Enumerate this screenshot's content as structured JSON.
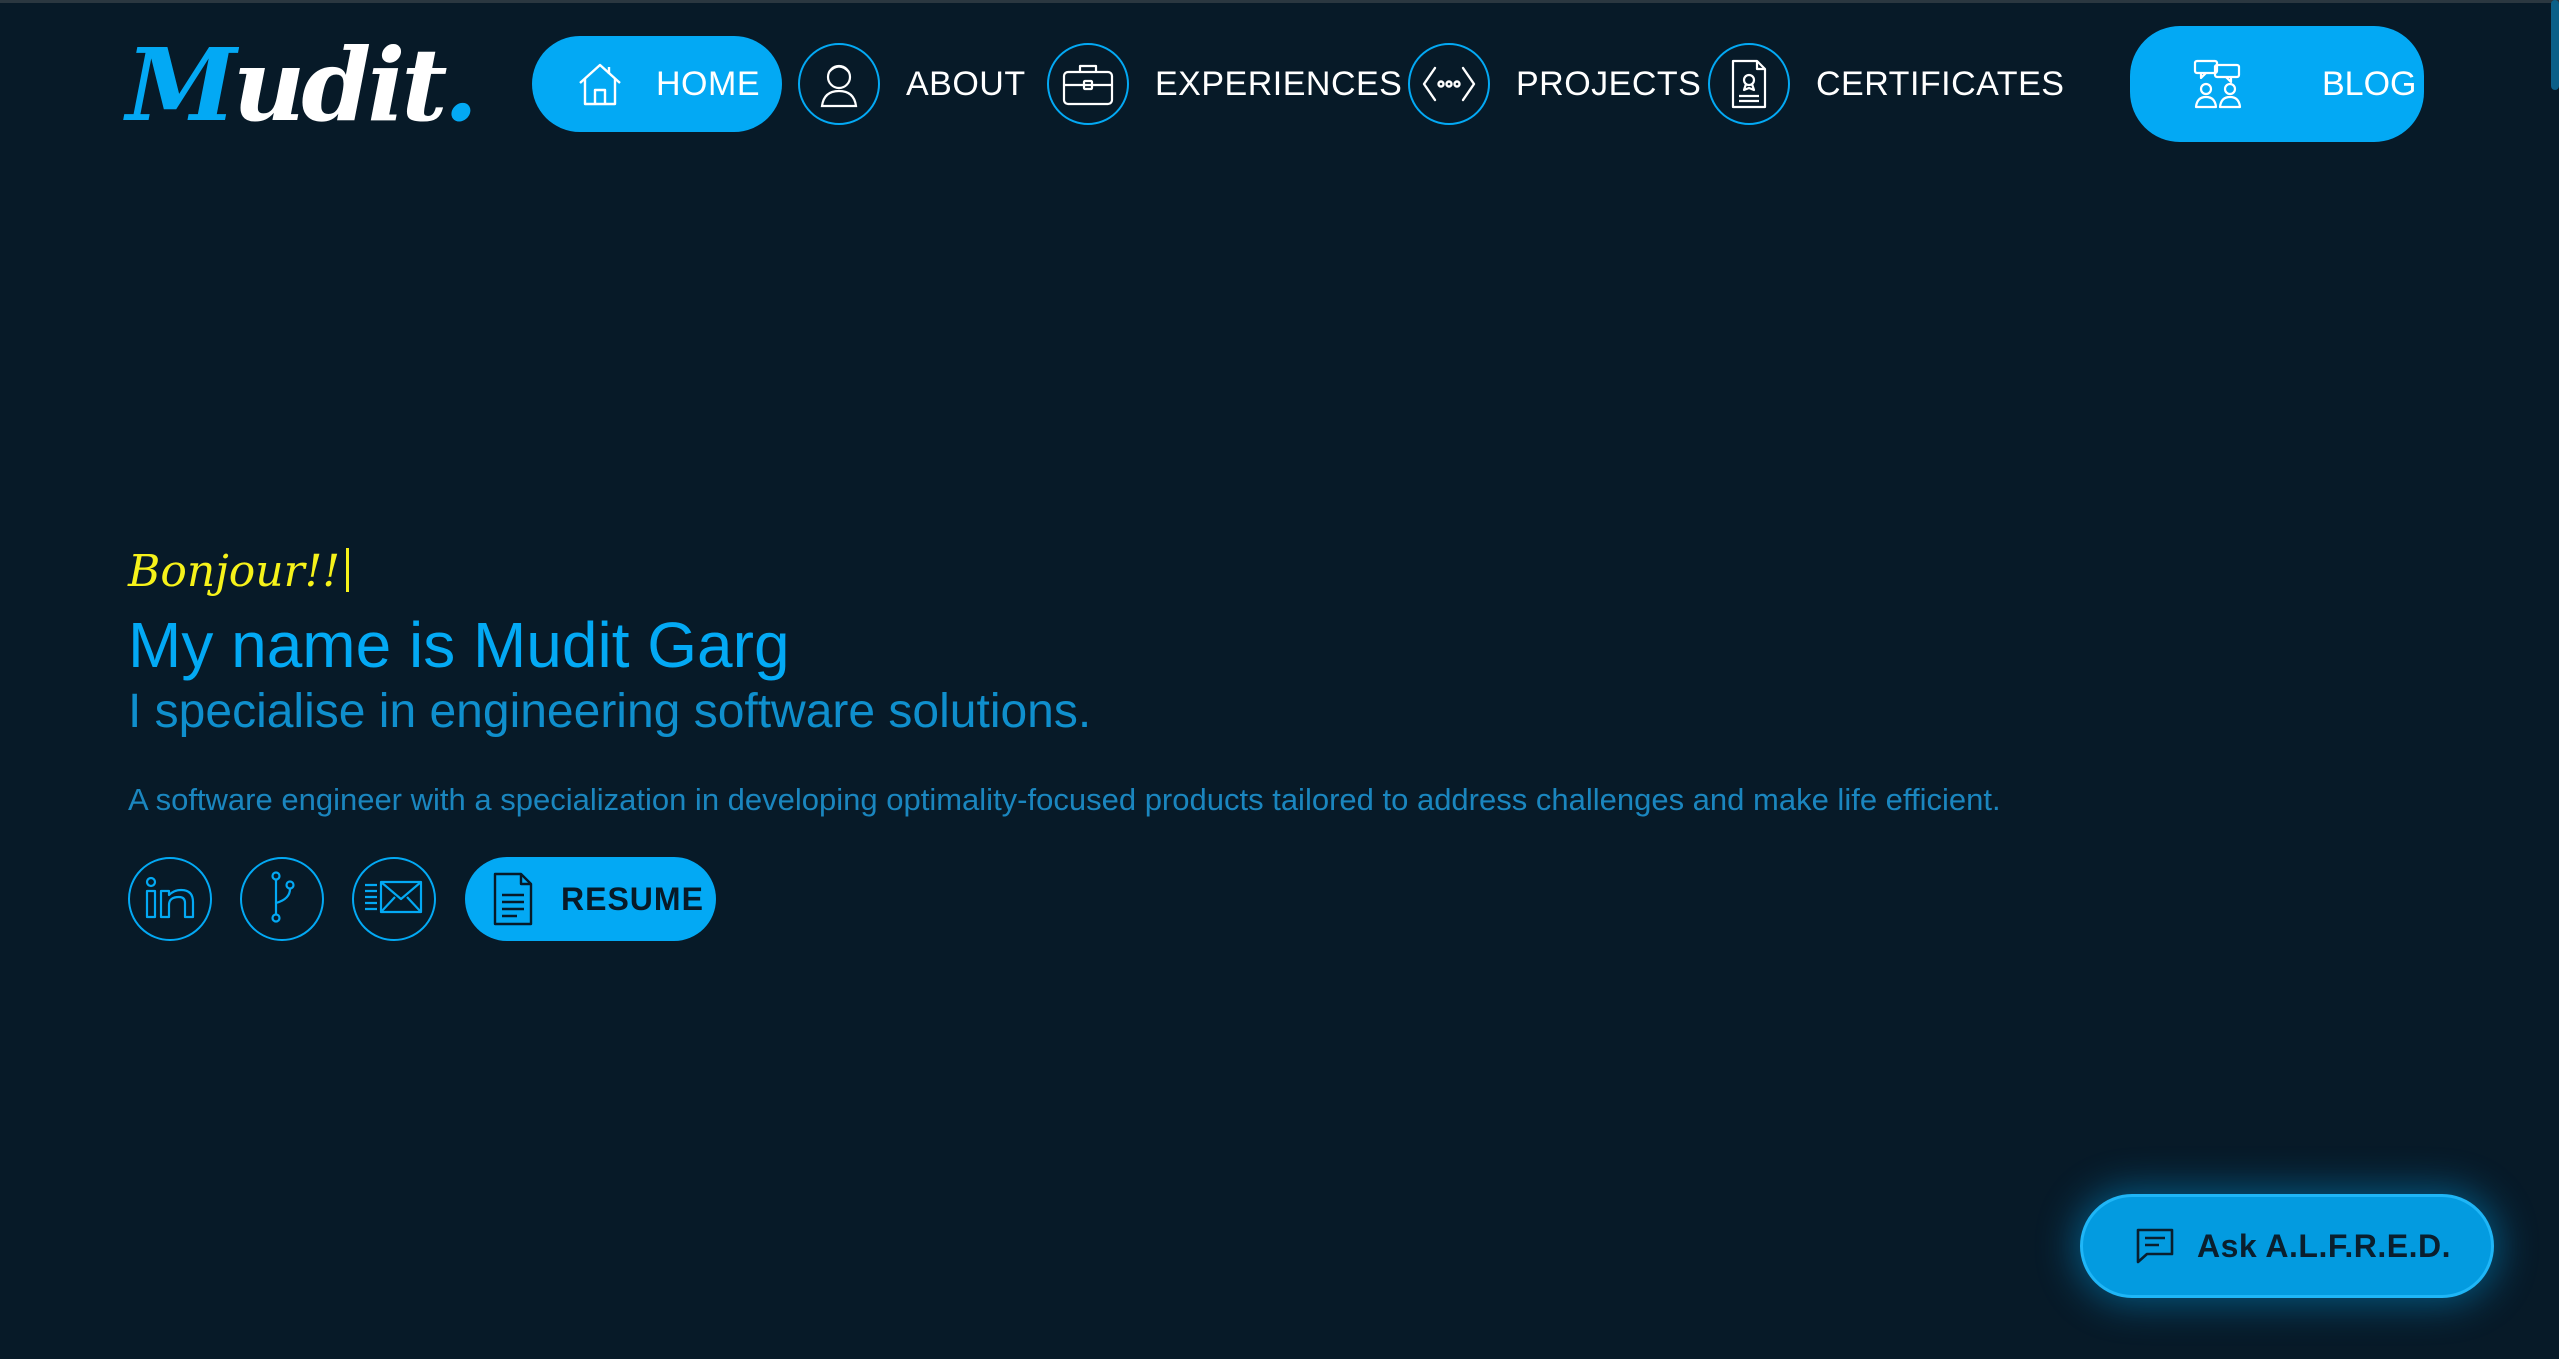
{
  "logo": {
    "first": "M",
    "rest": "udit",
    "dot": "."
  },
  "nav": {
    "items": [
      {
        "label": "HOME",
        "icon": "home-icon",
        "active": true
      },
      {
        "label": "ABOUT",
        "icon": "person-icon"
      },
      {
        "label": "EXPERIENCES",
        "icon": "briefcase-icon"
      },
      {
        "label": "PROJECTS",
        "icon": "code-icon"
      },
      {
        "label": "CERTIFICATES",
        "icon": "certificate-icon"
      }
    ],
    "blog_label": "BLOG",
    "blog_icon": "community-icon"
  },
  "hero": {
    "greeting": "Bonjour!!",
    "title": "My name is Mudit Garg",
    "subtitle": "I specialise in engineering software solutions.",
    "description": "A software engineer with a specialization in developing optimality-focused products tailored to address challenges and make life efficient.",
    "resume_label": "RESUME",
    "socials": [
      "linkedin-icon",
      "git-branch-icon",
      "email-icon"
    ]
  },
  "chat": {
    "label": "Ask A.L.F.R.E.D.",
    "icon": "chat-icon"
  },
  "colors": {
    "background": "#071a28",
    "accent": "#03a9f4",
    "greeting": "#f6f21a",
    "text": "#ffffff"
  }
}
